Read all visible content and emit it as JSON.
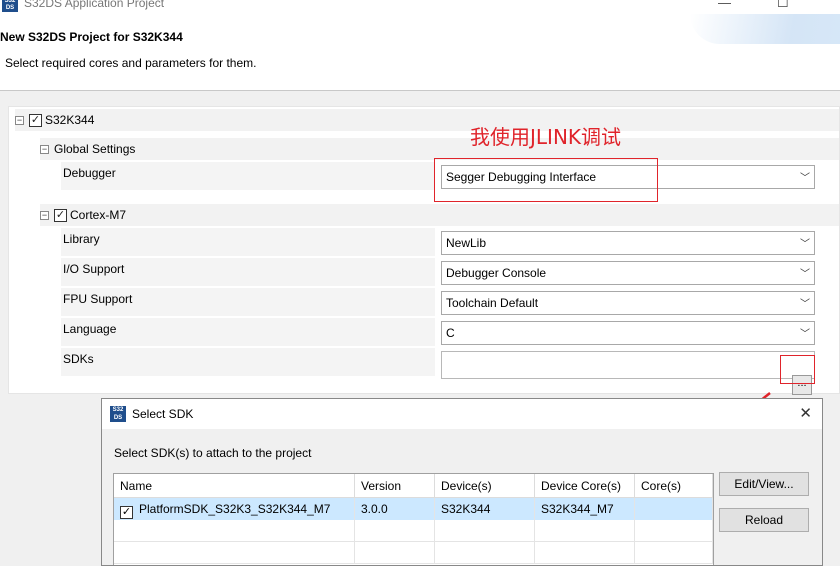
{
  "window": {
    "title": "S32DS Application Project",
    "icon_text": "S32 DS",
    "minimize": "—",
    "maximize": "☐"
  },
  "header": {
    "title": "New S32DS Project for S32K344",
    "description": "Select required cores and parameters for them."
  },
  "tree": {
    "root": {
      "label": "S32K344",
      "checked": true
    },
    "global_settings": {
      "label": "Global Settings",
      "debugger_label": "Debugger",
      "debugger_value": "Segger Debugging Interface"
    },
    "core": {
      "label": "Cortex-M7",
      "checked": true,
      "params": [
        {
          "label": "Library",
          "value": "NewLib"
        },
        {
          "label": "I/O Support",
          "value": "Debugger Console"
        },
        {
          "label": "FPU Support",
          "value": "Toolchain Default"
        },
        {
          "label": "Language",
          "value": "C"
        }
      ],
      "sdks_label": "SDKs",
      "sdks_button": "..."
    }
  },
  "annotation": {
    "text": "我使用JLINK调试",
    "color": "#e0242b"
  },
  "select_sdk_dialog": {
    "title": "Select SDK",
    "icon_text": "S32 DS",
    "close": "✕",
    "description": "Select SDK(s) to attach to the project",
    "columns": [
      "Name",
      "Version",
      "Device(s)",
      "Device Core(s)",
      "Core(s)"
    ],
    "rows": [
      {
        "checked": true,
        "name": "PlatformSDK_S32K3_S32K344_M7",
        "version": "3.0.0",
        "devices": "S32K344",
        "device_cores": "S32K344_M7",
        "cores": ""
      }
    ],
    "buttons": {
      "edit_view": "Edit/View...",
      "reload": "Reload"
    }
  },
  "colors": {
    "selection": "#cce8ff",
    "annotation": "#e0242b"
  }
}
